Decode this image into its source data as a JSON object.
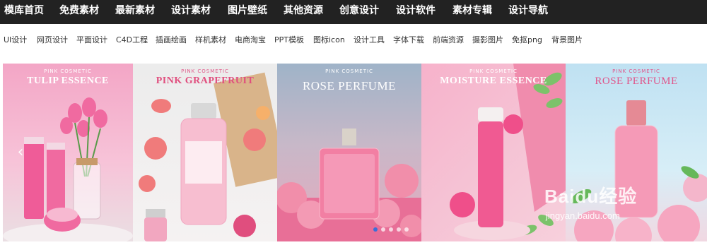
{
  "topnav": {
    "items": [
      "模库首页",
      "免费素材",
      "最新素材",
      "设计素材",
      "图片壁纸",
      "其他资源",
      "创意设计",
      "设计软件",
      "素材专辑",
      "设计导航"
    ]
  },
  "categories": [
    "UI设计",
    "网页设计",
    "平面设计",
    "C4D工程",
    "插画绘画",
    "样机素材",
    "电商淘宝",
    "PPT模板",
    "图标icon",
    "设计工具",
    "字体下载",
    "前端资源",
    "摄影图片",
    "免抠png",
    "背景图片"
  ],
  "banner": {
    "panels": [
      {
        "brand": "PINK COSMETIC",
        "title": "TULIP ESSENCE",
        "subtitle": "",
        "product_label": "TULIP\nESSENCE"
      },
      {
        "brand": "PINK COSMETIC",
        "title": "PINK GRAPEFRUIT",
        "subtitle": "",
        "product_label": "PINK\nGRAPEFRUIT"
      },
      {
        "brand": "PINK COSMETIC",
        "title": "ROSE PERFUME",
        "subtitle": "",
        "product_label": "ROSE PERFUME"
      },
      {
        "brand": "PINK COSMETIC",
        "title": "MOISTURE ESSENCE",
        "subtitle": "",
        "product_label": "MOISTURE\nESSENCE"
      },
      {
        "brand": "PINK COSMETIC",
        "title": "ROSE PERFUME",
        "subtitle": "",
        "product_label": "ROSE\nPERFUME"
      }
    ],
    "prev_arrow": "‹",
    "next_arrow": "›",
    "dot_count": 5,
    "active_dot": 0
  },
  "watermark": {
    "logo": "Baidu经验",
    "url": "jingyan.baidu.com"
  },
  "colors": {
    "topnav_bg": "#222222",
    "accent_dot": "#3a6fd8"
  }
}
